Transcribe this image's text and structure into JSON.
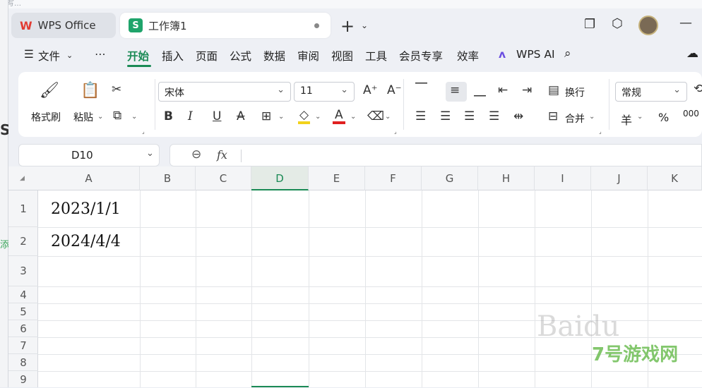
{
  "background": {
    "top_text": "填写…",
    "side_letter": "S",
    "side_green_text": "添"
  },
  "tabs": [
    {
      "label": "WPS Office",
      "icon": "wps-logo"
    },
    {
      "label": "工作簿1",
      "icon": "spreadsheet-logo",
      "modified": true
    }
  ],
  "menu": [
    "文件",
    "开始",
    "插入",
    "页面",
    "公式",
    "数据",
    "审阅",
    "视图",
    "工具",
    "会员专享",
    "效率",
    "WPS AI"
  ],
  "ribbon": {
    "format_painter": "格式刷",
    "paste": "粘贴",
    "font_name": "宋体",
    "font_size": "11",
    "wrap": "换行",
    "merge": "合并",
    "number_format": "常规",
    "currency": "羊",
    "percent": "%",
    "thousands": "000"
  },
  "formula_bar": {
    "cell_ref": "D10",
    "fx": "fx",
    "content": ""
  },
  "sheet": {
    "columns": [
      "A",
      "B",
      "C",
      "D",
      "E",
      "F",
      "G",
      "H",
      "I",
      "J",
      "K"
    ],
    "rows": [
      "1",
      "2",
      "3",
      "4",
      "5",
      "6",
      "7",
      "8",
      "9"
    ],
    "selected_column": "D",
    "cells": {
      "A1": "2023/1/1",
      "A2": "2024/4/4"
    }
  },
  "watermark": {
    "text": "Baidu",
    "site": "7号游戏网"
  }
}
